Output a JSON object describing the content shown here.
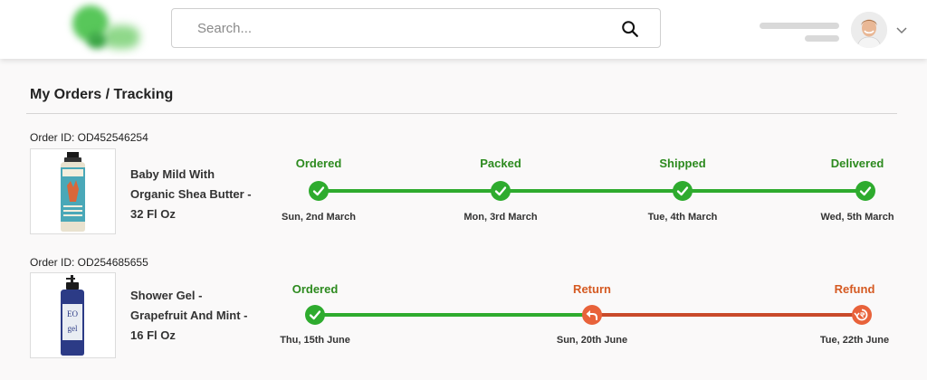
{
  "header": {
    "search": {
      "placeholder": "Search..."
    }
  },
  "page": {
    "title": "My Orders / Tracking"
  },
  "colors": {
    "green": "#2eab2e",
    "green_text": "#2c8a1e",
    "orange": "#e8623a",
    "orange_text": "#d55a22",
    "line_return": "#c94a2a"
  },
  "orders": [
    {
      "order_id": "Order ID: OD452546254",
      "product_name": "Baby Mild With Organic Shea Butter - 32 Fl Oz",
      "steps": [
        {
          "label": "Ordered",
          "date": "Sun, 2nd March",
          "status": "done"
        },
        {
          "label": "Packed",
          "date": "Mon, 3rd March",
          "status": "done"
        },
        {
          "label": "Shipped",
          "date": "Tue, 4th March",
          "status": "done"
        },
        {
          "label": "Delivered",
          "date": "Wed, 5th March",
          "status": "done"
        }
      ]
    },
    {
      "order_id": "Order ID: OD254685655",
      "product_name": "Shower Gel - Grapefruit And Mint - 16 Fl Oz",
      "steps": [
        {
          "label": "Ordered",
          "date": "Thu, 15th June",
          "status": "done"
        },
        {
          "label": "Return",
          "date": "Sun, 20th June",
          "status": "return"
        },
        {
          "label": "Refund",
          "date": "Tue, 22th June",
          "status": "refund"
        }
      ]
    }
  ]
}
